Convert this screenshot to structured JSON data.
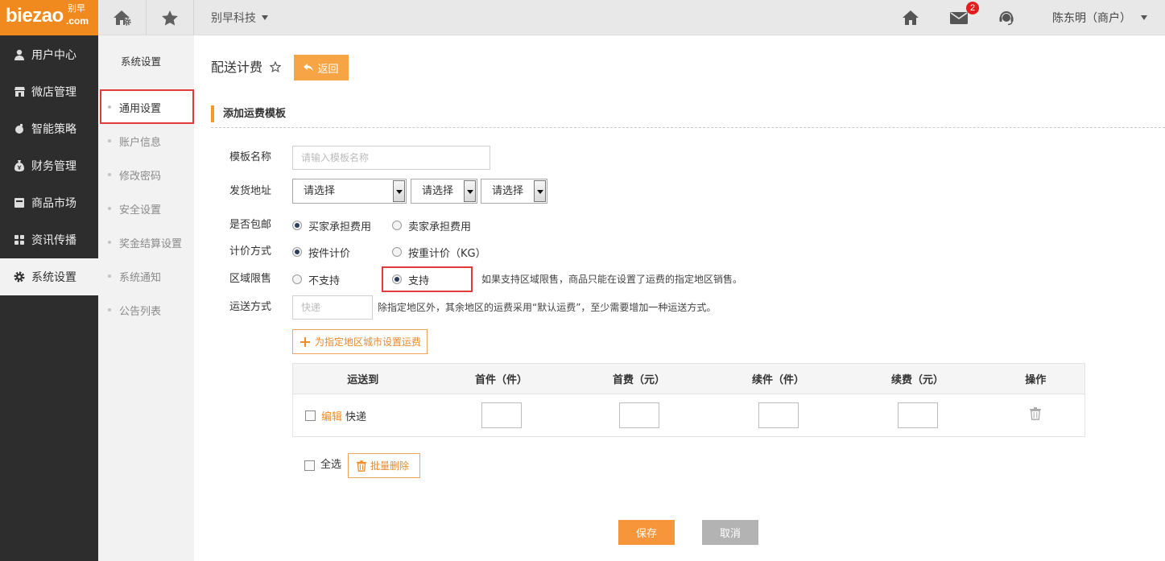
{
  "colors": {
    "brand": "#f08a1e",
    "accent": "#f6953a",
    "annotation": "#e23b3b",
    "sidebar": "#2d2d2d",
    "light": "#f2f2f2"
  },
  "logo": {
    "text": "biezao",
    "cn": "别早",
    "domain": ".com"
  },
  "topbar": {
    "left_icons": [
      "home-settings-icon",
      "star-icon"
    ],
    "company": "别早科技",
    "right_icons": [
      "home-icon",
      "mail-icon",
      "headset-icon"
    ],
    "mail_badge": "2",
    "user": "陈东明（商户）"
  },
  "sidebar": {
    "items": [
      {
        "label": "用户中心",
        "icon": "user-icon",
        "active": false
      },
      {
        "label": "微店管理",
        "icon": "shop-icon",
        "active": false
      },
      {
        "label": "智能策略",
        "icon": "bomb-icon",
        "active": false
      },
      {
        "label": "财务管理",
        "icon": "money-bag-icon",
        "active": false
      },
      {
        "label": "商品市场",
        "icon": "box-icon",
        "active": false
      },
      {
        "label": "资讯传播",
        "icon": "grid-icon",
        "active": false
      },
      {
        "label": "系统设置",
        "icon": "gear-icon",
        "active": true
      }
    ]
  },
  "subnav": {
    "title": "系统设置",
    "items": [
      {
        "label": "通用设置",
        "active": true
      },
      {
        "label": "账户信息",
        "active": false
      },
      {
        "label": "修改密码",
        "active": false
      },
      {
        "label": "安全设置",
        "active": false
      },
      {
        "label": "奖金结算设置",
        "active": false
      },
      {
        "label": "系统通知",
        "active": false
      },
      {
        "label": "公告列表",
        "active": false
      }
    ]
  },
  "page": {
    "title": "配送计费",
    "back": "返回"
  },
  "section": {
    "title": "添加运费模板"
  },
  "form": {
    "template_name": {
      "label": "模板名称",
      "value": "",
      "placeholder": "请输入模板名称"
    },
    "address": {
      "label": "发货地址",
      "selects": [
        "请选择",
        "请选择",
        "请选择"
      ]
    },
    "free_shipping": {
      "label": "是否包邮",
      "options": [
        {
          "label": "买家承担费用",
          "checked": true
        },
        {
          "label": "卖家承担费用",
          "checked": false
        }
      ]
    },
    "pricing": {
      "label": "计价方式",
      "options": [
        {
          "label": "按件计价",
          "checked": true
        },
        {
          "label": "按重计价（KG）",
          "checked": false
        }
      ]
    },
    "region": {
      "label": "区域限售",
      "options": [
        {
          "label": "不支持",
          "checked": false
        },
        {
          "label": "支持",
          "checked": true
        }
      ],
      "hint": "如果支持区域限售，商品只能在设置了运费的指定地区销售。"
    },
    "delivery": {
      "label": "运送方式",
      "value": "",
      "placeholder": "快递",
      "hint": "除指定地区外，其余地区的运费采用“默认运费”，至少需要增加一种运送方式。"
    },
    "add_region_button": "为指定地区城市设置运费"
  },
  "table": {
    "columns": [
      "运送到",
      "首件（件）",
      "首费（元）",
      "续件（件）",
      "续费（元）",
      "操作"
    ],
    "rows": [
      {
        "checked": false,
        "edit": "编辑",
        "method": "快递",
        "first_qty": "",
        "first_fee": "",
        "extra_qty": "",
        "extra_fee": ""
      }
    ]
  },
  "bulk": {
    "select_all": "全选",
    "select_all_checked": false,
    "delete": "批量删除"
  },
  "actions": {
    "save": "保存",
    "cancel": "取消"
  }
}
